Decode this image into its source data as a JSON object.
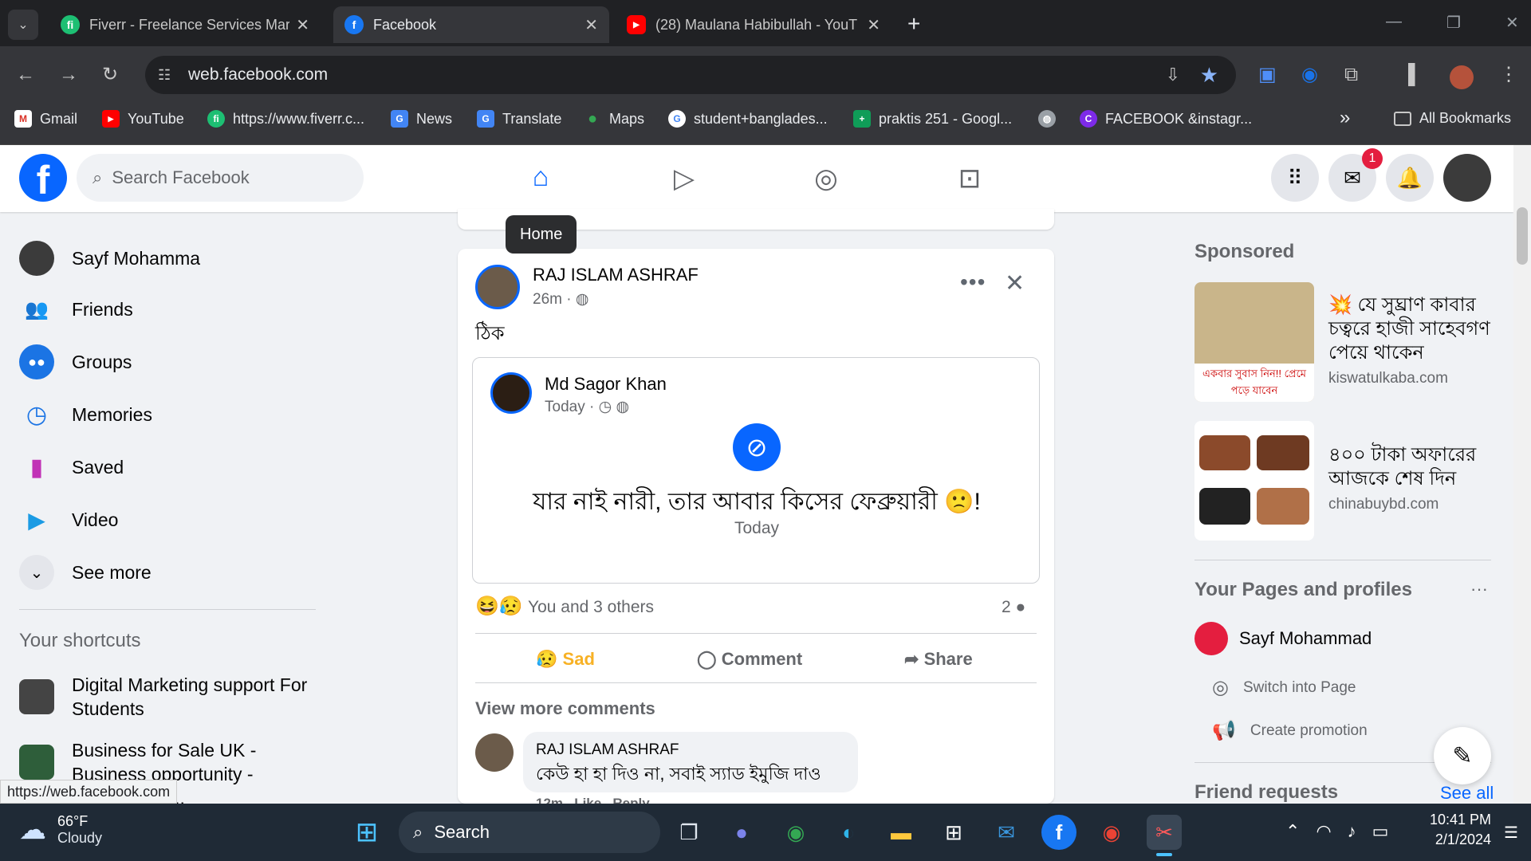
{
  "browser": {
    "tabs": [
      {
        "title": "Fiverr - Freelance Services Mark",
        "close": "✕"
      },
      {
        "title": "Facebook",
        "close": "✕"
      },
      {
        "title": "(28) Maulana Habibullah - YouT",
        "close": "✕"
      }
    ],
    "new_tab": "+",
    "url": "web.facebook.com",
    "bookmarks": [
      "Gmail",
      "YouTube",
      "https://www.fiverr.c...",
      "News",
      "Translate",
      "Maps",
      "student+banglades...",
      "praktis 251 - Googl...",
      "FACEBOOK &instagr..."
    ],
    "more_bookmarks": "»",
    "all_bookmarks": "All Bookmarks",
    "status_url": "https://web.facebook.com"
  },
  "header": {
    "search_placeholder": "Search Facebook",
    "home_tooltip": "Home",
    "messenger_badge": "1"
  },
  "left_nav": {
    "items": [
      "Sayf Mohamma",
      "Friends",
      "Groups",
      "Memories",
      "Saved",
      "Video",
      "See more"
    ],
    "shortcuts_title": "Your shortcuts",
    "shortcuts": [
      "Digital Marketing support For Students",
      "Business for Sale UK - Business opportunity - Commercial..."
    ]
  },
  "post": {
    "author": "RAJ ISLAM ASHRAF",
    "time": "26m ·",
    "text": "ঠিক",
    "shared_author": "Md Sagor Khan",
    "shared_time": "Today ·",
    "shared_text": "যার নাই নারী, তার আবার কিসের ফেব্রুয়ারী 🙁!",
    "shared_sub": "Today",
    "reactions": "You and 3 others",
    "comment_count": "2",
    "actions": {
      "sad": "Sad",
      "comment": "Comment",
      "share": "Share"
    },
    "view_more": "View more comments",
    "comment_author": "RAJ ISLAM ASHRAF",
    "comment_text": "কেউ হা হা দিও না, সবাই স্যাড ইমুজি দাও",
    "comment_meta": "12m   Like   Reply"
  },
  "right_col": {
    "sponsored_title": "Sponsored",
    "ads": [
      {
        "text": "💥 যে সুঘ্রাণ কাবার চত্বরে হাজী সাহেবগণ পেয়ে থাকেন",
        "domain": "kiswatulkaba.com",
        "img_caption": "একবার সুবাস নিন!! প্রেমে পড়ে যাবেন"
      },
      {
        "text": "৪০০ টাকা অফারের আজকে শেষ দিন",
        "domain": "chinabuybd.com"
      }
    ],
    "pages_title": "Your Pages and profiles",
    "pages_more": "···",
    "page_name": "Sayf Mohammad",
    "switch": "Switch into Page",
    "promo": "Create promotion",
    "friend_requests": "Friend requests",
    "see_all": "See all"
  },
  "taskbar": {
    "weather_temp": "66°F",
    "weather_desc": "Cloudy",
    "search": "Search",
    "time": "10:41 PM",
    "date": "2/1/2024"
  }
}
